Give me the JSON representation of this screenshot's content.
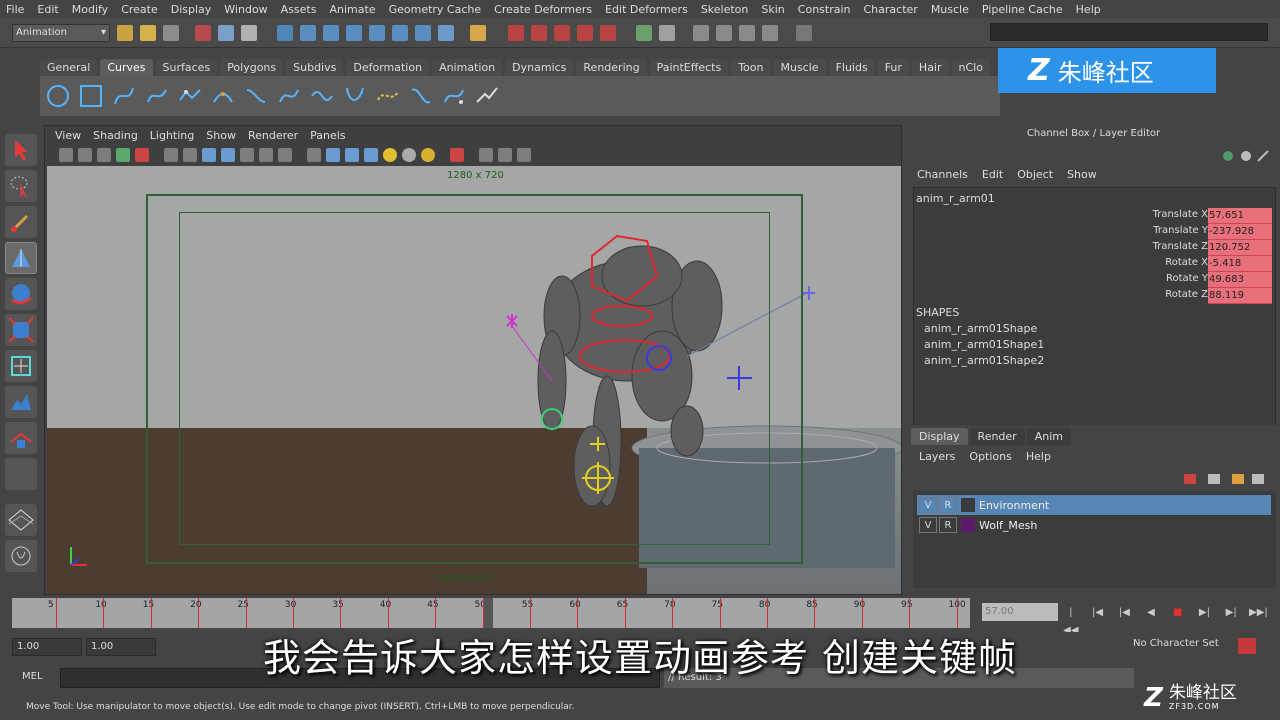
{
  "menubar": [
    "File",
    "Edit",
    "Modify",
    "Create",
    "Display",
    "Window",
    "Assets",
    "Animate",
    "Geometry Cache",
    "Create Deformers",
    "Edit Deformers",
    "Skeleton",
    "Skin",
    "Constrain",
    "Character",
    "Muscle",
    "Pipeline Cache",
    "Help"
  ],
  "statusline": {
    "mode": "Animation"
  },
  "shelf": {
    "tabs": [
      "General",
      "Curves",
      "Surfaces",
      "Polygons",
      "Subdivs",
      "Deformation",
      "Animation",
      "Dynamics",
      "Rendering",
      "PaintEffects",
      "Toon",
      "Muscle",
      "Fluids",
      "Fur",
      "Hair",
      "nClo"
    ],
    "active_tab": "Curves"
  },
  "watermark": {
    "logo_text": "朱峰社区",
    "corner_text": "朱峰社区",
    "corner_url": "ZF3D.COM"
  },
  "viewport": {
    "menu": [
      "View",
      "Shading",
      "Lighting",
      "Show",
      "Renderer",
      "Panels"
    ],
    "resolution_label": "1280 x 720",
    "camera_label": "shotCam01"
  },
  "channel_box": {
    "title": "Channel Box / Layer Editor",
    "menu": [
      "Channels",
      "Edit",
      "Object",
      "Show"
    ],
    "object": "anim_r_arm01",
    "attributes": [
      {
        "label": "Translate X",
        "value": "57.651"
      },
      {
        "label": "Translate Y",
        "value": "-237.928"
      },
      {
        "label": "Translate Z",
        "value": "120.752"
      },
      {
        "label": "Rotate X",
        "value": "-5.418"
      },
      {
        "label": "Rotate Y",
        "value": "49.683"
      },
      {
        "label": "Rotate Z",
        "value": "88.119"
      }
    ],
    "shapes_header": "SHAPES",
    "shapes": [
      "anim_r_arm01Shape",
      "anim_r_arm01Shape1",
      "anim_r_arm01Shape2"
    ]
  },
  "layer_editor": {
    "tabs": [
      "Display",
      "Render",
      "Anim"
    ],
    "active_tab": "Display",
    "menu": [
      "Layers",
      "Options",
      "Help"
    ],
    "layers": [
      {
        "v": "V",
        "r": "R",
        "name": "Environment",
        "color": "#3a3a3a",
        "selected": true
      },
      {
        "v": "V",
        "r": "R",
        "name": "Wolf_Mesh",
        "color": "#5a1a6a",
        "selected": false
      }
    ]
  },
  "timeline": {
    "ticks": [
      "5",
      "10",
      "15",
      "20",
      "25",
      "30",
      "35",
      "40",
      "45",
      "50",
      "55",
      "60",
      "65",
      "70",
      "75",
      "80",
      "85",
      "90",
      "95",
      "100"
    ],
    "current_frame": 51,
    "current_time": "57.00"
  },
  "range": {
    "start": "1.00",
    "current": "1.00",
    "character_set": "No Character Set"
  },
  "command": {
    "label": "MEL",
    "result": "// Result: 3"
  },
  "helpline": "Move Tool: Use manipulator to move object(s). Use edit mode to change pivot (INSERT). Ctrl+LMB to move perpendicular.",
  "subtitle": "我会告诉大家怎样设置动画参考  创建关键帧"
}
